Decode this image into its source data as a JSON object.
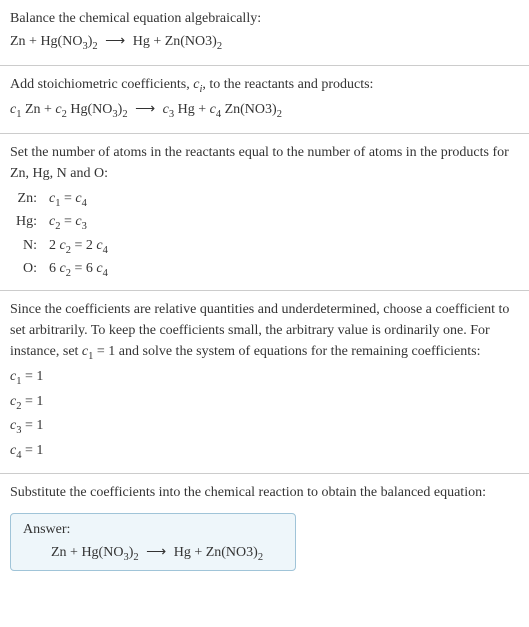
{
  "section1": {
    "heading": "Balance the chemical equation algebraically:",
    "lhs1": "Zn + Hg(NO",
    "lhs2": ")",
    "arrow": "⟶",
    "rhs1": "Hg + Zn(NO3)",
    "sub3": "3",
    "sub2": "2"
  },
  "section2": {
    "heading_a": "Add stoichiometric coefficients, ",
    "heading_ci": "c",
    "heading_i": "i",
    "heading_b": ", to the reactants and products:",
    "c1": "c",
    "n1": "1",
    "t1": " Zn + ",
    "c2": "c",
    "n2": "2",
    "t2": " Hg(NO",
    "s3": "3",
    "t3": ")",
    "s2": "2",
    "arrow": "⟶",
    "c3": "c",
    "n3": "3",
    "t4": " Hg + ",
    "c4": "c",
    "n4": "4",
    "t5": " Zn(NO3)",
    "s2b": "2"
  },
  "section3": {
    "heading": "Set the number of atoms in the reactants equal to the number of atoms in the products for Zn, Hg, N and O:",
    "rows": [
      {
        "el": "Zn:",
        "lhs_c": "c",
        "lhs_n": "1",
        "eq": " = ",
        "rhs_c": "c",
        "rhs_n": "4",
        "pre": "",
        "mid": ""
      },
      {
        "el": "Hg:",
        "lhs_c": "c",
        "lhs_n": "2",
        "eq": " = ",
        "rhs_c": "c",
        "rhs_n": "3",
        "pre": "",
        "mid": ""
      },
      {
        "el": "N:",
        "lhs_c": "c",
        "lhs_n": "2",
        "eq": " = 2 ",
        "rhs_c": "c",
        "rhs_n": "4",
        "pre": "2 ",
        "mid": ""
      },
      {
        "el": "O:",
        "lhs_c": "c",
        "lhs_n": "2",
        "eq": " = 6 ",
        "rhs_c": "c",
        "rhs_n": "4",
        "pre": "6 ",
        "mid": ""
      }
    ]
  },
  "section4": {
    "heading_a": "Since the coefficients are relative quantities and underdetermined, choose a coefficient to set arbitrarily. To keep the coefficients small, the arbitrary value is ordinarily one. For instance, set ",
    "heading_c": "c",
    "heading_1": "1",
    "heading_b": " = 1 and solve the system of equations for the remaining coefficients:",
    "lines": [
      {
        "c": "c",
        "n": "1",
        "v": " = 1"
      },
      {
        "c": "c",
        "n": "2",
        "v": " = 1"
      },
      {
        "c": "c",
        "n": "3",
        "v": " = 1"
      },
      {
        "c": "c",
        "n": "4",
        "v": " = 1"
      }
    ]
  },
  "section5": {
    "heading": "Substitute the coefficients into the chemical reaction to obtain the balanced equation:"
  },
  "answer": {
    "label": "Answer:",
    "lhs1": "Zn + Hg(NO",
    "s3": "3",
    "lhs2": ")",
    "s2": "2",
    "arrow": "⟶",
    "rhs": "Hg + Zn(NO3)",
    "s2b": "2"
  }
}
